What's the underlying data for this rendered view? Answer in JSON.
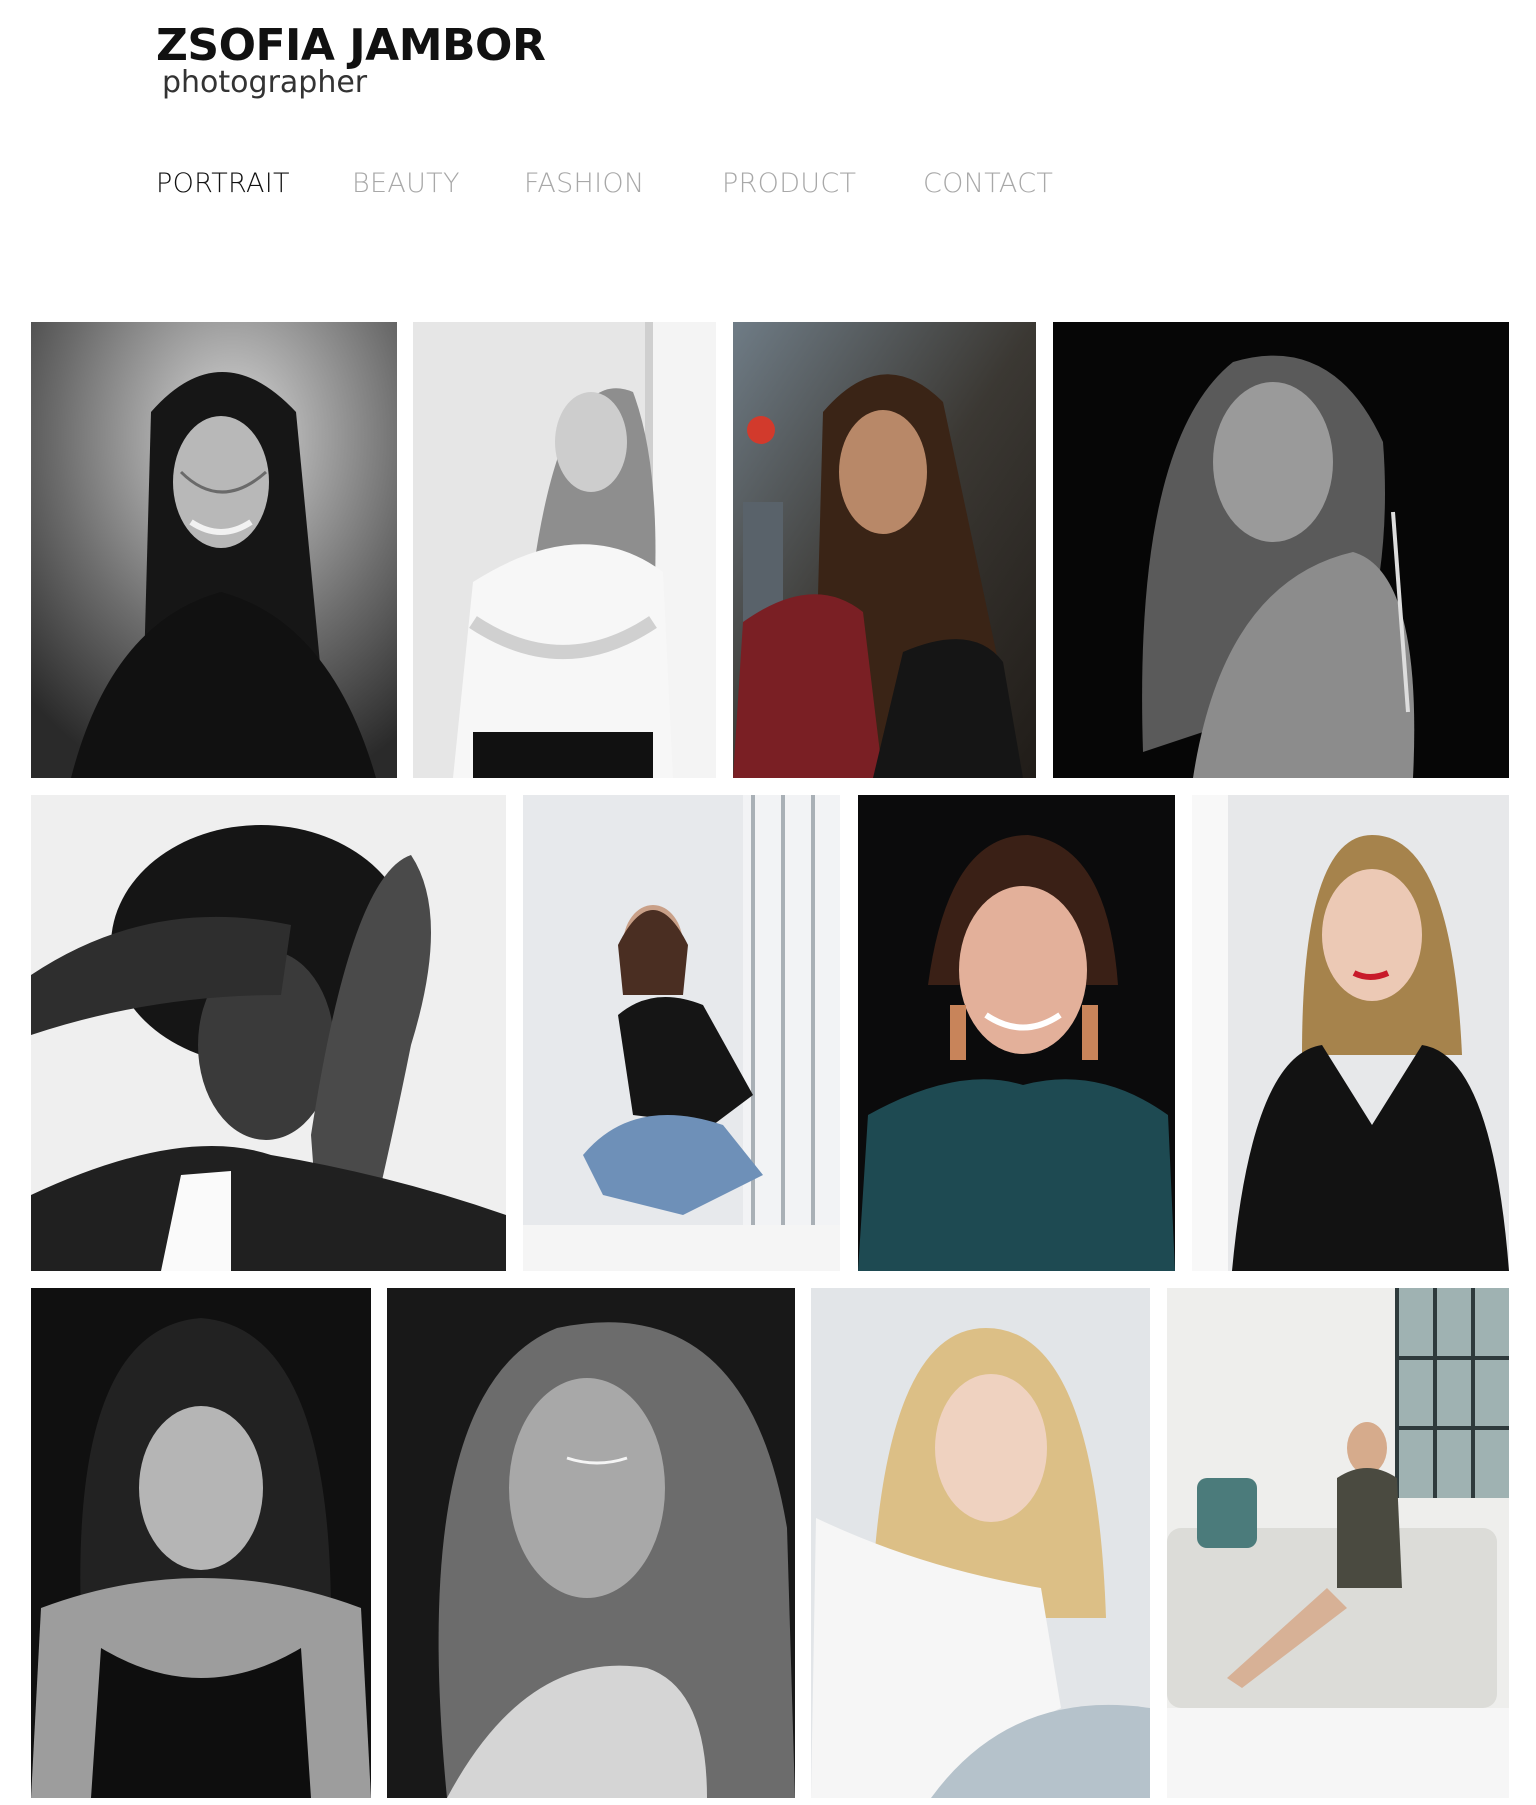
{
  "site": {
    "name": "ZSOFIA JAMBOR",
    "tagline": "photographer"
  },
  "nav": {
    "items": [
      {
        "label": "PORTRAIT",
        "active": true
      },
      {
        "label": "BEAUTY",
        "active": false
      },
      {
        "label": "FASHION",
        "active": false
      },
      {
        "label": "PRODUCT",
        "active": false
      },
      {
        "label": "CONTACT",
        "active": false
      }
    ]
  },
  "colors": {
    "logo_text": "#111111",
    "nav_active": "#111111",
    "nav_inactive": "#a8a8a8",
    "background": "#ffffff"
  },
  "gallery": {
    "photos": [
      {
        "name": "portrait-photo-1",
        "style": "black-and-white",
        "description": "smiling woman, long dark hair, black jacket"
      },
      {
        "name": "portrait-photo-2",
        "style": "black-and-white",
        "description": "woman in white sweater leaning on wall, arms crossed"
      },
      {
        "name": "portrait-photo-3",
        "style": "color",
        "description": "woman with long brown hair, red cardigan, city street"
      },
      {
        "name": "portrait-photo-4",
        "style": "black-and-white",
        "description": "woman looking over bare shoulder, dark background"
      },
      {
        "name": "portrait-photo-5",
        "style": "black-and-white",
        "description": "woman with curly hair, hands raised near face"
      },
      {
        "name": "portrait-photo-6",
        "style": "color",
        "description": "woman sitting by window, black top and jeans"
      },
      {
        "name": "portrait-photo-7",
        "style": "color",
        "description": "smiling woman, teal top, tassel earrings"
      },
      {
        "name": "portrait-photo-8",
        "style": "color",
        "description": "blonde woman, black v-neck dress, red lips"
      },
      {
        "name": "portrait-photo-9",
        "style": "black-and-white",
        "description": "woman with dark curly hair, black tank top"
      },
      {
        "name": "portrait-photo-10",
        "style": "black-and-white",
        "description": "freckled woman, eyes closed, looking down"
      },
      {
        "name": "portrait-photo-11",
        "style": "color",
        "description": "blonde woman in white shirt leaning on sofa"
      },
      {
        "name": "portrait-photo-12",
        "style": "color",
        "description": "woman in patterned dress sitting on white sofa"
      }
    ]
  }
}
